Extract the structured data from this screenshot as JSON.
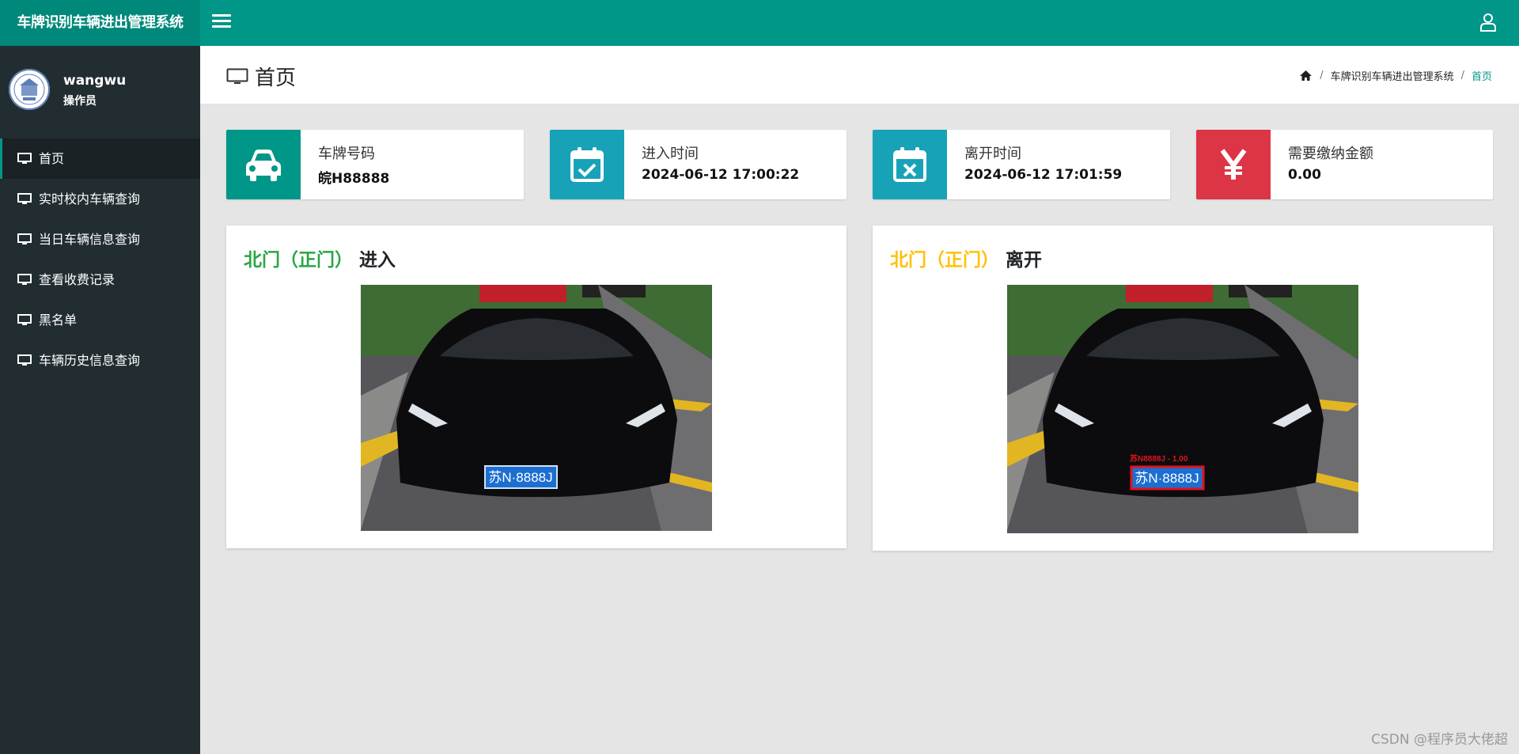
{
  "app": {
    "title": "车牌识别车辆进出管理系统"
  },
  "user": {
    "name": "wangwu",
    "role": "操作员"
  },
  "sidebar": {
    "items": [
      {
        "label": "首页"
      },
      {
        "label": "实时校内车辆查询"
      },
      {
        "label": "当日车辆信息查询"
      },
      {
        "label": "查看收费记录"
      },
      {
        "label": "黑名单"
      },
      {
        "label": "车辆历史信息查询"
      }
    ]
  },
  "header": {
    "page_title": "首页",
    "breadcrumb": [
      "车牌识别车辆进出管理系统",
      "首页"
    ]
  },
  "info_boxes": [
    {
      "label": "车牌号码",
      "value": "皖H88888",
      "icon": "car-icon",
      "color": "#009688"
    },
    {
      "label": "进入时间",
      "value": "2024-06-12 17:00:22",
      "icon": "calendar-check-icon",
      "color": "#17a2b8"
    },
    {
      "label": "离开时间",
      "value": "2024-06-12 17:01:59",
      "icon": "calendar-times-icon",
      "color": "#17a2b8"
    },
    {
      "label": "需要缴纳金额",
      "value": "0.00",
      "icon": "yen-icon",
      "color": "#dc3545"
    }
  ],
  "entry_card": {
    "gate": "北门（正门）",
    "action": "进入",
    "gate_color": "#28a745",
    "plate_text": "苏N·8888J"
  },
  "exit_card": {
    "gate": "北门（正门）",
    "action": "离开",
    "gate_color": "#ffc107",
    "plate_text": "苏N·8888J",
    "detection_label": "苏N8888J - 1.00"
  },
  "watermark": "CSDN @程序员大佬超",
  "colors": {
    "primary": "#009688",
    "sidebar": "#222d32"
  }
}
